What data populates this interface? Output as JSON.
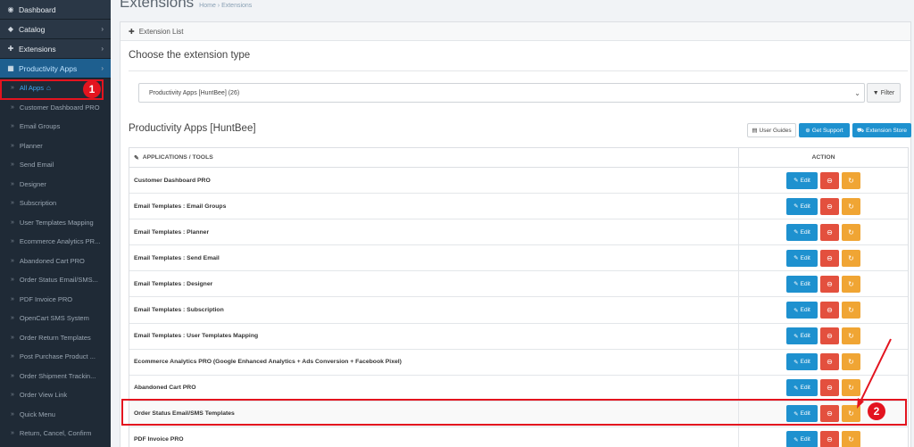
{
  "sidebar": {
    "top_items": [
      {
        "label": "Dashboard",
        "icon": "dashboard-icon",
        "glyph": "◉",
        "chevron": ""
      },
      {
        "label": "Catalog",
        "icon": "tag-icon",
        "glyph": "◆",
        "chevron": "›"
      },
      {
        "label": "Extensions",
        "icon": "puzzle-icon",
        "glyph": "✚",
        "chevron": "›"
      },
      {
        "label": "Productivity Apps",
        "icon": "windows-icon",
        "glyph": "▦",
        "chevron": "›"
      }
    ],
    "sub_items": [
      "All Apps",
      "Customer Dashboard PRO",
      "Email Groups",
      "Planner",
      "Send Email",
      "Designer",
      "Subscription",
      "User Templates Mapping",
      "Ecommerce Analytics PR...",
      "Abandoned Cart PRO",
      "Order Status Email/SMS...",
      "PDF Invoice PRO",
      "OpenCart SMS System",
      "Order Return Templates",
      "Post Purchase Product ...",
      "Order Shipment Trackin...",
      "Order View Link",
      "Quick Menu",
      "Return, Cancel, Confirm"
    ],
    "quote_glyph": "»",
    "home_glyph": "⌂"
  },
  "header": {
    "title": "Extensions",
    "breadcrumb": "Home  ›  Extensions"
  },
  "panel": {
    "heading": "Extension List",
    "heading_glyph": "✚",
    "choose_label": "Choose the extension type",
    "select_value": "Productivity Apps [HuntBee] (26)",
    "select_caret": "⌄",
    "filter_label": "Filter",
    "filter_glyph": "▼",
    "apps_title": "Productivity Apps [HuntBee]",
    "user_guides_label": "User Guides",
    "user_guides_glyph": "▤",
    "get_support_label": "Get Support",
    "get_support_glyph": "⊕",
    "extension_store_label": "Extension Store",
    "extension_store_glyph": "⛟"
  },
  "table": {
    "col_app": "APPLICATIONS / TOOLS",
    "col_app_glyph": "✎",
    "col_action": "ACTION",
    "edit_label": "Edit",
    "edit_glyph": "✎",
    "delete_glyph": "⊖",
    "refresh_glyph": "↻",
    "rows": [
      "Customer Dashboard PRO",
      "Email Templates : Email Groups",
      "Email Templates : Planner",
      "Email Templates : Send Email",
      "Email Templates : Designer",
      "Email Templates : Subscription",
      "Email Templates : User Templates Mapping",
      "Ecommerce Analytics PRO (Google Enhanced Analytics + Ads Conversion + Facebook Pixel)",
      "Abandoned Cart PRO",
      "Order Status Email/SMS Templates",
      "PDF Invoice PRO"
    ]
  },
  "annotations": {
    "badge1": "1",
    "badge2": "2",
    "color": "#e3141f"
  },
  "colors": {
    "sidebar_bg": "#1f2a36",
    "accent_blue": "#1e91cf",
    "danger_red": "#e3503e",
    "warning_orange": "#f0a534"
  }
}
